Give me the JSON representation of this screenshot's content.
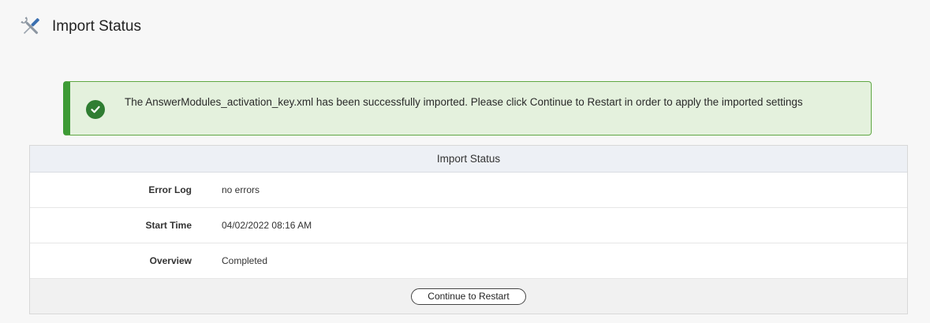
{
  "header": {
    "title": "Import Status",
    "icon": "tools-icon"
  },
  "alert": {
    "icon": "check-circle-icon",
    "message": "The AnswerModules_activation_key.xml has been successfully imported. Please click Continue to Restart in order to apply the imported settings",
    "colors": {
      "background": "#e4f1dd",
      "border": "#3d9b35",
      "icon": "#2f7d32"
    }
  },
  "panel": {
    "title": "Import Status",
    "rows": [
      {
        "label": "Error Log",
        "value": "no errors"
      },
      {
        "label": "Start Time",
        "value": "04/02/2022 08:16 AM"
      },
      {
        "label": "Overview",
        "value": "Completed"
      }
    ],
    "button_label": "Continue to Restart"
  }
}
